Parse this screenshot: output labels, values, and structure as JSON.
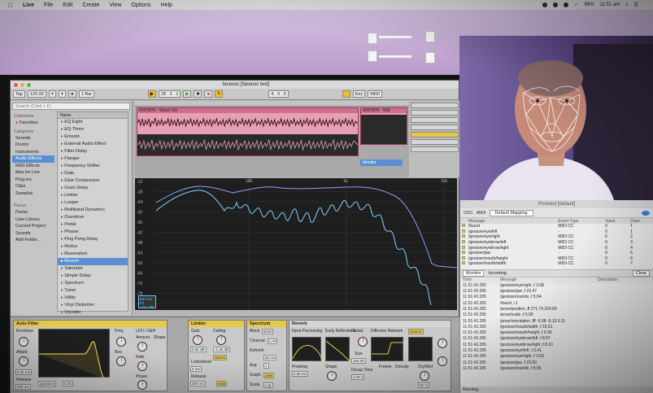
{
  "menubar": {
    "apple": "",
    "items": [
      "Live",
      "File",
      "Edit",
      "Create",
      "View",
      "Options",
      "Help"
    ],
    "time": "11:51 am",
    "battery": "89%"
  },
  "window": {
    "title": "faceosc [faceosc test]"
  },
  "transport": {
    "tap": "Tap",
    "tempo": "120.00",
    "sig_num": "4",
    "sig_den": "4",
    "quant": "1 Bar",
    "pos": "28 . 2 . 1",
    "end": "4 . 0 . 0",
    "key": "Key",
    "midi": "MIDI"
  },
  "browser": {
    "search_placeholder": "Search (Cmd + F)",
    "collections_head": "Collections",
    "collections": [
      "Favorites"
    ],
    "categories_head": "Categories",
    "categories": [
      "Sounds",
      "Drums",
      "Instruments",
      "Audio Effects",
      "MIDI Effects",
      "Max for Live",
      "Plug-ins",
      "Clips",
      "Samples"
    ],
    "places_head": "Places",
    "places": [
      "Packs",
      "User Library",
      "Current Project",
      "Sounds",
      "Add Folder..."
    ],
    "name_header": "Name",
    "names": [
      "EQ Eight",
      "EQ Three",
      "Erosion",
      "External Audio Effect",
      "Filter Delay",
      "Flanger",
      "Frequency Shifter",
      "Gate",
      "Glue Compressor",
      "Grain Delay",
      "Limiter",
      "Looper",
      "Multiband Dynamics",
      "Overdrive",
      "Pedal",
      "Phaser",
      "Ping Pong Delay",
      "Redux",
      "Resonators",
      "Reverb",
      "Saturator",
      "Simple Delay",
      "Spectrum",
      "Tuner",
      "Utility",
      "Vinyl Distortion",
      "Vocoder"
    ],
    "selected": "Reverb"
  },
  "arrangement": {
    "clip1": "ANOWHI - Watch Me",
    "clip2": "ANOWHI - Wat",
    "monitor": "Monitor"
  },
  "spectrum": {
    "db_ticks": [
      "-12",
      "-18",
      "-24",
      "-30",
      "-36",
      "-42",
      "-48",
      "-54",
      "-60",
      "-66",
      "-72",
      "-78",
      "-84"
    ],
    "freq_ticks": [
      "100",
      "1k",
      "10k"
    ],
    "readout_l1": "89.5 Hz",
    "readout_l2": "F2",
    "readout_l3": "-43.1 dB"
  },
  "devices": {
    "autofilter": {
      "name": "Auto Filter",
      "envelope": "Envelope",
      "attack": "Attack",
      "release": "Release",
      "freq": "Freq",
      "res": "Res",
      "lfo": "LFO / S&H",
      "amount": "Amount",
      "shape": "Shape",
      "rate": "Rate",
      "phase": "Phase",
      "offset": "Offset",
      "quantize": "Quantize",
      "v1": "0.00",
      "v2": "6.00 ms",
      "v3": "200 ms"
    },
    "limiter": {
      "name": "Limiter",
      "gain": "Gain",
      "ceiling": "Ceiling",
      "lookahead": "Lookahead",
      "release": "Release",
      "auto": "Auto",
      "stereo": "Stereo",
      "v1": "0.00 dB",
      "v2": "-0.30 dB",
      "v3": "3 ms",
      "v4": "300 ms"
    },
    "spectrum": {
      "name": "Spectrum",
      "block": "Block",
      "channel": "Channel",
      "refresh": "Refresh",
      "avg": "Avg",
      "graph": "Graph",
      "scale": "Scale",
      "v1": "8192",
      "v2": "L+R",
      "v3": "60 ms",
      "v4": "1",
      "v5": "Line",
      "v6": "Log"
    },
    "reverb": {
      "name": "Reverb",
      "input": "Input Processing",
      "early": "Early Reflections",
      "global": "Global",
      "diffusion": "Diffusion Network",
      "chorus": "Chorus",
      "predelay": "Predelay",
      "shape": "Shape",
      "size": "Size",
      "decay": "Decay Time",
      "freeze": "Freeze",
      "density": "Density",
      "dry": "Dry/Wet",
      "v1": "2.50 ms",
      "v2": "100.00",
      "v3": "1.20 s",
      "v4": "50 %"
    }
  },
  "osc": {
    "title": "Protokol [default]",
    "toolbar": [
      "OSC",
      "MIDI"
    ],
    "mapping": "Default Mapping",
    "cols": [
      "Message",
      "Event Type",
      "Value",
      "Chan"
    ],
    "rows": [
      [
        "/found",
        "MIDI CC",
        "0",
        "1"
      ],
      [
        "/gesture/eye/left",
        "-",
        "0",
        "1"
      ],
      [
        "/gesture/eye/right",
        "MIDI CC",
        "0",
        "2"
      ],
      [
        "/gesture/eyebrow/left",
        "MIDI CC",
        "0",
        "3"
      ],
      [
        "/gesture/eyebrow/right",
        "MIDI CC",
        "0",
        "4"
      ],
      [
        "/gesture/jaw",
        "-",
        "0",
        "5"
      ],
      [
        "/gesture/mouth/height",
        "MIDI CC",
        "0",
        "6"
      ],
      [
        "/gesture/mouth/width",
        "MIDI CC",
        "0",
        "7"
      ]
    ],
    "tabs": [
      "Monitor",
      "Incoming"
    ],
    "clear": "Clear",
    "log_cols": [
      "Time",
      "Message",
      "Description"
    ],
    "log": [
      [
        "11:51:43.285",
        "/gesture/eye/right ,f 3.08"
      ],
      [
        "11:51:43.285",
        "/gesture/jaw ,f 23.47"
      ],
      [
        "11:51:43.285",
        "/gesture/nostrils ,f 5.54"
      ],
      [
        "11:51:43.285",
        "/found ,i 1"
      ],
      [
        "11:51:43.285",
        "/pose/position ,ff 271.74 224.83"
      ],
      [
        "11:51:43.285",
        "/pose/scale ,f 6.09"
      ],
      [
        "11:51:43.285",
        "/pose/orientation ,fff -0.08 -0.13 0.11"
      ],
      [
        "11:51:43.285",
        "/gesture/mouth/width ,f 15.51"
      ],
      [
        "11:51:43.285",
        "/gesture/mouth/height ,f 6.90"
      ],
      [
        "11:51:43.285",
        "/gesture/eyebrow/left ,f 8.07"
      ],
      [
        "11:51:43.285",
        "/gesture/eyebrow/right ,f 8.10"
      ],
      [
        "11:51:43.285",
        "/gesture/eye/left ,f 3.41"
      ],
      [
        "11:51:43.285",
        "/gesture/eye/right ,f 3.03"
      ],
      [
        "11:51:43.285",
        "/gesture/jaw ,f 23.50"
      ],
      [
        "11:51:43.285",
        "/gesture/nostrils ,f 5.55"
      ]
    ],
    "status": "Running..."
  },
  "colors": {
    "accent": "#5a8fd6",
    "clip": "#e6a0b4",
    "device_header": "#e7c94a",
    "spectrum_line": "#7fd3ff",
    "mesh": "#ffffff"
  }
}
